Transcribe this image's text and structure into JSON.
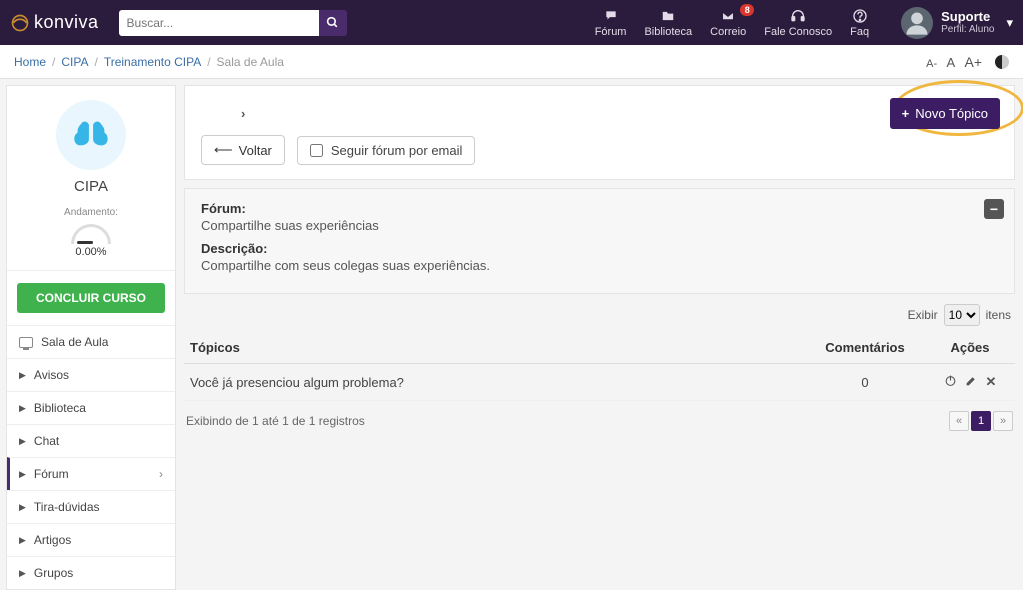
{
  "brand": "konviva",
  "search": {
    "placeholder": "Buscar..."
  },
  "nav": {
    "forum": "Fórum",
    "biblioteca": "Biblioteca",
    "correio": "Correio",
    "correio_badge": "8",
    "fale": "Fale Conosco",
    "faq": "Faq"
  },
  "user": {
    "name": "Suporte",
    "role": "Perfil: Aluno"
  },
  "breadcrumbs": {
    "home": "Home",
    "cipa": "CIPA",
    "trein": "Treinamento CIPA",
    "sala": "Sala de Aula"
  },
  "fontsizes": {
    "small": "A-",
    "mid": "A",
    "big": "A+"
  },
  "sidebar": {
    "course": "CIPA",
    "progress_label": "Andamento:",
    "progress_pct": "0.00%",
    "conclude": "CONCLUIR CURSO",
    "items": {
      "sala": "Sala de Aula",
      "avisos": "Avisos",
      "biblioteca": "Biblioteca",
      "chat": "Chat",
      "forum": "Fórum",
      "tira": "Tira-dúvidas",
      "artigos": "Artigos",
      "grupos": "Grupos"
    }
  },
  "main": {
    "novo": "Novo Tópico",
    "voltar": "Voltar",
    "follow": "Seguir fórum por email",
    "forum_label": "Fórum:",
    "forum_title": "Compartilhe suas experiências",
    "desc_label": "Descrição:",
    "desc_text": "Compartilhe com seus colegas suas experiências.",
    "exibir": "Exibir",
    "itens": "itens",
    "page_size": "10",
    "th_topicos": "Tópicos",
    "th_coment": "Comentários",
    "th_acoes": "Ações",
    "row_title": "Você já presenciou algum problema?",
    "row_comments": "0",
    "footer_info": "Exibindo de 1 até 1 de 1 registros",
    "page_cur": "1"
  }
}
